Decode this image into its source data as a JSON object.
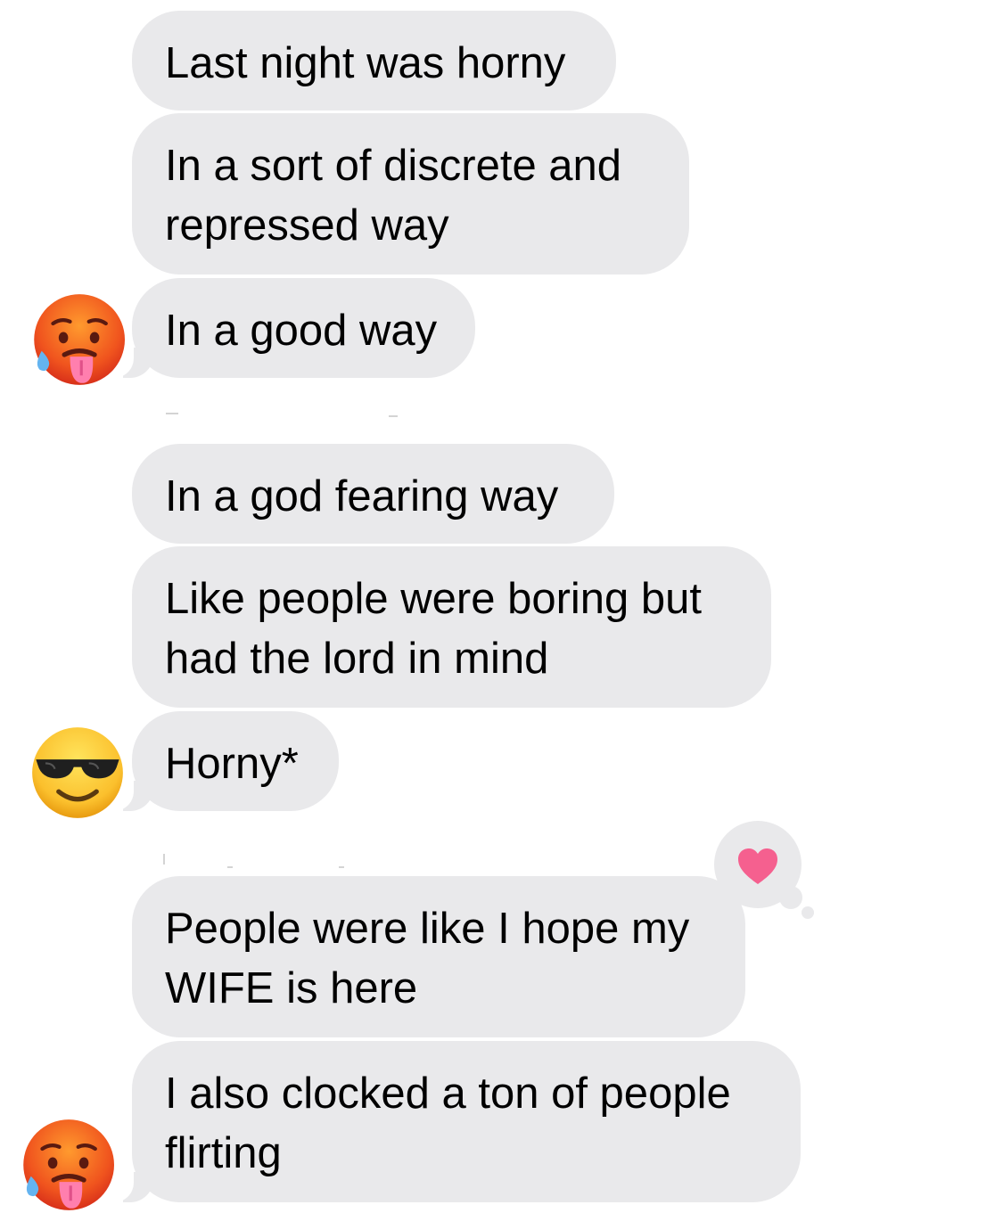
{
  "colors": {
    "bubble_gray": "#e9e9eb",
    "heart_pink": "#f5608f",
    "text": "#000000"
  },
  "messages": [
    {
      "text": "Last night was horny"
    },
    {
      "text": "In a sort of discrete and\nrepressed way"
    },
    {
      "text": "In a good way",
      "avatar": "hot-face-emoji-icon"
    },
    {
      "text": "In a god fearing way"
    },
    {
      "text": "Like people were boring but\nhad the lord in mind"
    },
    {
      "text": "Horny*",
      "avatar": "sunglasses-face-emoji-icon"
    },
    {
      "text": "People were like I hope my\nWIFE is here",
      "tapback": "heart-icon"
    },
    {
      "text": "I also clocked a ton of people\nflirting",
      "avatar": "hot-face-emoji-icon"
    }
  ]
}
